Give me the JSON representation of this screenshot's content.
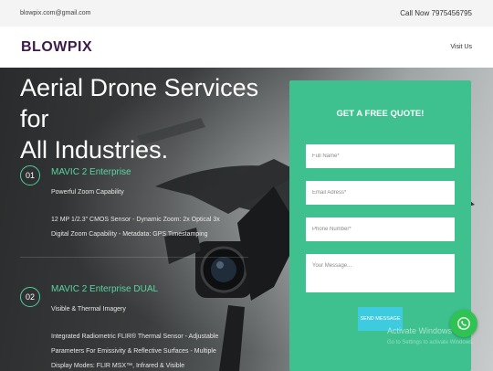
{
  "topbar": {
    "email": "blowpix.com@gmail.com",
    "phone": "Call Now 7975456795"
  },
  "navbar": {
    "logo": "BLOWPIX",
    "visit_us": "Visit Us"
  },
  "hero": {
    "heading_line1": "Aerial Drone Services for",
    "heading_line2": "All Industries.",
    "features": [
      {
        "number": "01",
        "title": "MAVIC 2 Enterprise",
        "subtitle": "Powerful Zoom Capability",
        "desc_line1": "12 MP 1/2.3\" CMOS Sensor - Dynamic Zoom: 2x Optical 3x",
        "desc_line2": "Digital Zoom Capability - Metadata: GPS Timestamping"
      },
      {
        "number": "02",
        "title": "MAVIC 2 Enterprise DUAL",
        "subtitle": "Visible & Thermal Imagery",
        "desc_line1": "Integrated Radiometric FLIR® Thermal Sensor - Adjustable",
        "desc_line2": "Parameters For Emissivity & Reflective Surfaces - Multiple",
        "desc_line3": "Display Modes: FLIR MSX™, Infrared & Visible"
      }
    ]
  },
  "quote_form": {
    "title": "GET A FREE QUOTE!",
    "full_name_placeholder": "Full Name*",
    "email_placeholder": "Email Adress*",
    "phone_placeholder": "Phone Number*",
    "message_placeholder": "Your Message...",
    "send_label": "SEND MESSAGE"
  },
  "overlay": {
    "activate_title": "Activate Windows",
    "activate_sub": "Go to Settings to activate Windows.",
    "whatsapp_icon": "whatsapp-icon"
  },
  "colors": {
    "accent_green": "#3ec18e",
    "feature_green": "#58d6a2",
    "send_button": "#3ecbe0",
    "logo": "#3c1a4a",
    "whatsapp": "#2fc451"
  }
}
